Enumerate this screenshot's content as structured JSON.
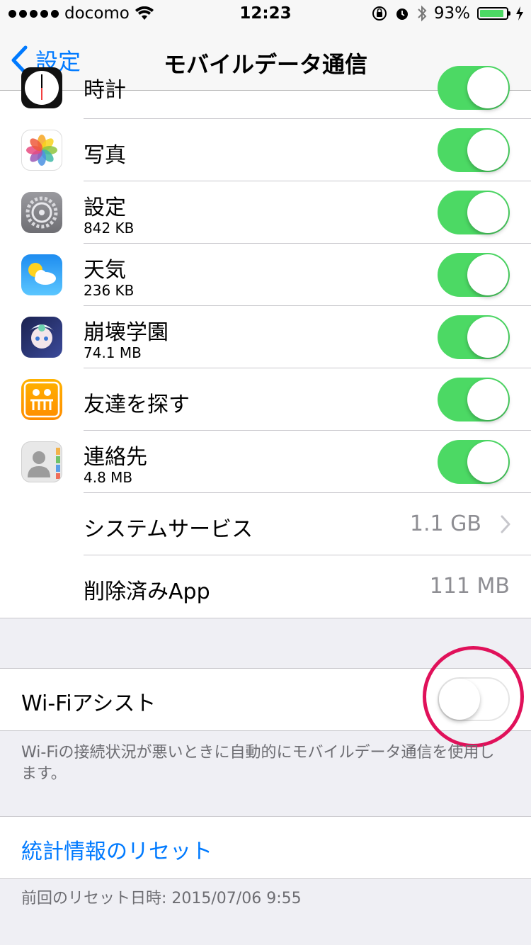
{
  "status_bar": {
    "carrier": "docomo",
    "time": "12:23",
    "battery": "93%"
  },
  "nav": {
    "back_label": "設定",
    "title": "モバイルデータ通信"
  },
  "apps": [
    {
      "name": "時計",
      "size": "",
      "icon": "clock-icon",
      "enabled": true
    },
    {
      "name": "写真",
      "size": "",
      "icon": "photos-icon",
      "enabled": true
    },
    {
      "name": "設定",
      "size": "842 KB",
      "icon": "settings-icon",
      "enabled": true
    },
    {
      "name": "天気",
      "size": "236 KB",
      "icon": "weather-icon",
      "enabled": true
    },
    {
      "name": "崩壊学園",
      "size": "74.1 MB",
      "icon": "game-icon",
      "enabled": true
    },
    {
      "name": "友達を探す",
      "size": "",
      "icon": "find-friends-icon",
      "enabled": true
    },
    {
      "name": "連絡先",
      "size": "4.8 MB",
      "icon": "contacts-icon",
      "enabled": true
    }
  ],
  "system_services": {
    "label": "システムサービス",
    "value": "1.1 GB"
  },
  "deleted_apps": {
    "label": "削除済みApp",
    "value": "111 MB"
  },
  "wifi_assist": {
    "label": "Wi-Fiアシスト",
    "enabled": false,
    "description": "Wi-Fiの接続状況が悪いときに自動的にモバイルデータ通信を使用します。"
  },
  "reset": {
    "label": "統計情報のリセット",
    "last_reset": "前回のリセット日時: 2015/07/06 9:55"
  },
  "colors": {
    "accent": "#007aff",
    "toggle_on": "#4cd964",
    "highlight": "#e0115a"
  }
}
